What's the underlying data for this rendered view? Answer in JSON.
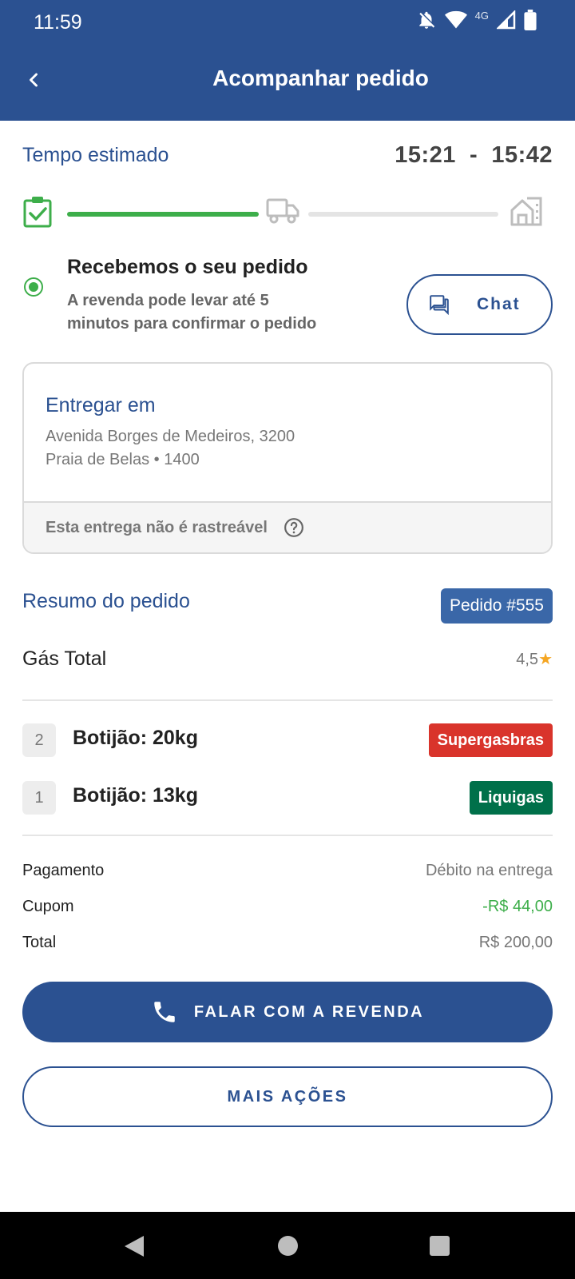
{
  "status_bar": {
    "time": "11:59",
    "network": "4G"
  },
  "header": {
    "title": "Acompanhar pedido"
  },
  "eta": {
    "label": "Tempo estimado",
    "value": "15:21  -  15:42"
  },
  "tracking": {
    "steps": [
      "clipboard-check-icon",
      "truck-icon",
      "house-icon"
    ],
    "progress": 0.5,
    "colors": {
      "done": "#3DAE4A",
      "pending": "#E4E4E4",
      "inactive_icon": "#BDBDBD"
    }
  },
  "status": {
    "title": "Recebemos o seu pedido",
    "description": "A revenda pode levar até 5\n minutos para confirmar o pedido",
    "chat_label": "Chat"
  },
  "delivery": {
    "title": "Entregar em",
    "address_line1": "Avenida Borges de Medeiros, 3200",
    "address_line2": "Praia de Belas • 1400",
    "tracking_note": "Esta entrega não é rastreável"
  },
  "summary": {
    "label": "Resumo do pedido",
    "order_badge": "Pedido #555",
    "vendor": "Gás Total",
    "rating": "4,5",
    "items": [
      {
        "qty": "2",
        "name": "Botijão: 20kg",
        "brand": "Supergasbras",
        "brand_color": "#D9342B"
      },
      {
        "qty": "1",
        "name": "Botijão: 13kg",
        "brand": "Liquigas",
        "brand_color": "#00704A"
      }
    ]
  },
  "payment": {
    "method_label": "Pagamento",
    "method_value": "Débito na entrega",
    "coupon_label": "Cupom",
    "coupon_value": "-R$ 44,00",
    "total_label": "Total",
    "total_value": "R$ 200,00"
  },
  "actions": {
    "primary": "FALAR COM A REVENDA",
    "secondary": "MAIS AÇÕES"
  },
  "theme": {
    "primary": "#2B5191",
    "success": "#3DAE4A"
  }
}
